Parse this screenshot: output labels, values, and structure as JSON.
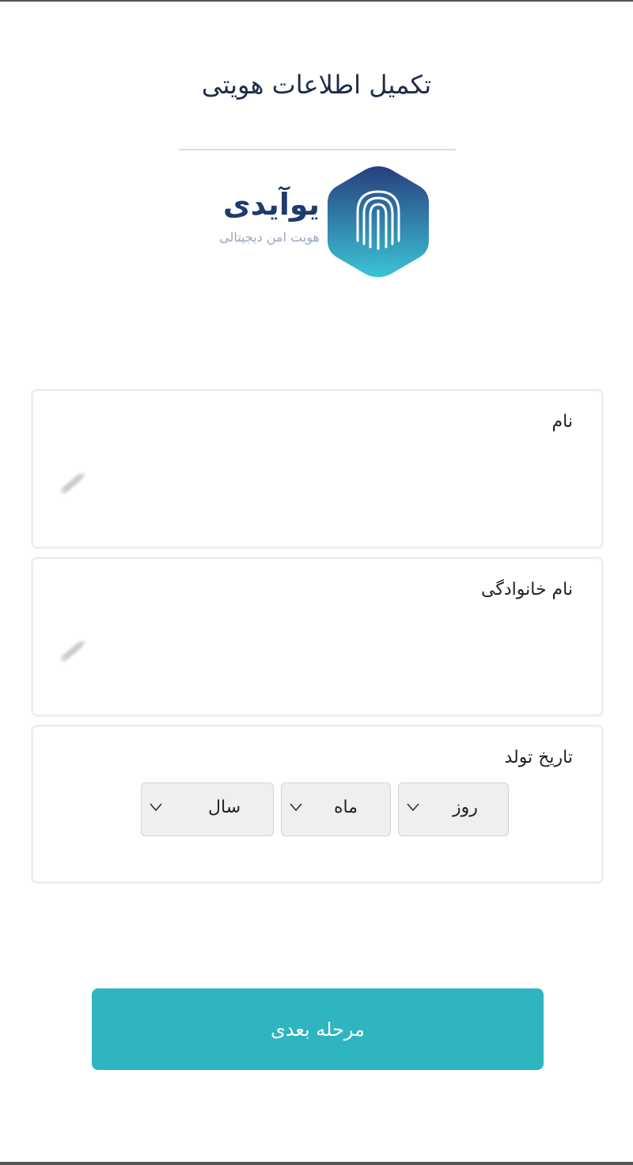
{
  "header": {
    "title": "تکمیل اطلاعات هویتی"
  },
  "brand": {
    "name": "یوآیدی",
    "tagline": "هویت امن دیجیتالی",
    "logo_icon": "fingerprint-icon",
    "colors": {
      "hex_top": "#273f7e",
      "hex_bottom": "#3cc4d6"
    }
  },
  "form": {
    "first_name": {
      "label": "نام",
      "value": ""
    },
    "last_name": {
      "label": "نام خانوادگی",
      "value": ""
    },
    "birth_date": {
      "label": "تاریخ تولد",
      "day": "روز",
      "month": "ماه",
      "year": "سال"
    }
  },
  "actions": {
    "next_label": "مرحله بعدی"
  },
  "colors": {
    "accent": "#2eb5bf",
    "title": "#1d2c4a"
  }
}
